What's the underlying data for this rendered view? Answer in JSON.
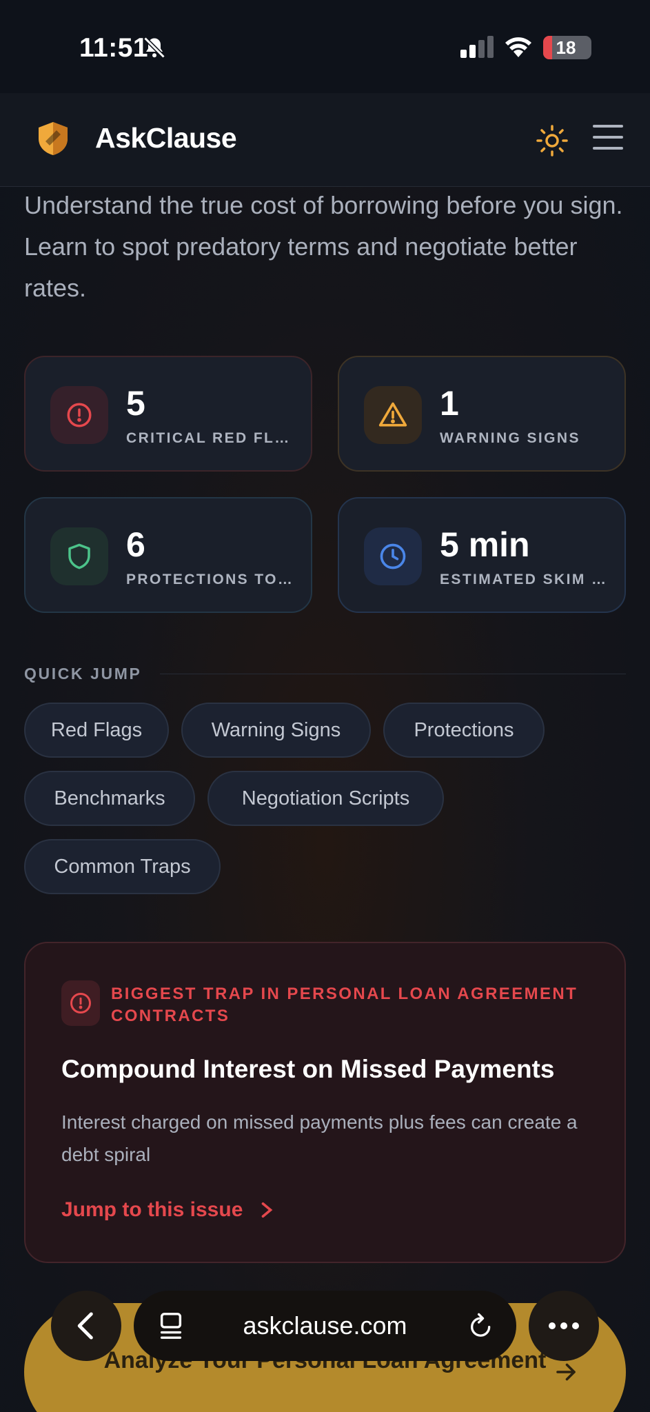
{
  "status_bar": {
    "time": "11:51",
    "battery": "18",
    "battery_level": 0.18
  },
  "header": {
    "brand": "AskClause"
  },
  "intro": "Understand the true cost of borrowing before you sign. Learn to spot predatory terms and negotiate better rates.",
  "stats": [
    {
      "value": "5",
      "label": "CRITICAL RED FLAGS",
      "icon": "alert-circle-icon",
      "color": "#e5484d"
    },
    {
      "value": "1",
      "label": "WARNING SIGNS",
      "icon": "warning-triangle-icon",
      "color": "#f0a93b"
    },
    {
      "value": "6",
      "label": "PROTECTIONS TO KNOW",
      "icon": "shield-icon",
      "color": "#4cc38a"
    },
    {
      "value": "5 min",
      "label": "ESTIMATED SKIM TIME",
      "icon": "clock-icon",
      "color": "#4a86e8"
    }
  ],
  "quick_jump": {
    "title": "QUICK JUMP",
    "chips": [
      "Red Flags",
      "Warning Signs",
      "Protections",
      "Benchmarks",
      "Negotiation Scripts",
      "Common Traps"
    ]
  },
  "trap": {
    "eyebrow": "BIGGEST TRAP IN PERSONAL LOAN AGREEMENT CONTRACTS",
    "title": "Compound Interest on Missed Payments",
    "description": "Interest charged on missed payments plus fees can create a debt spiral",
    "link": "Jump to this issue"
  },
  "cta": {
    "label": "Analyze Your Personal Loan Agreement"
  },
  "browser": {
    "url": "askclause.com"
  }
}
